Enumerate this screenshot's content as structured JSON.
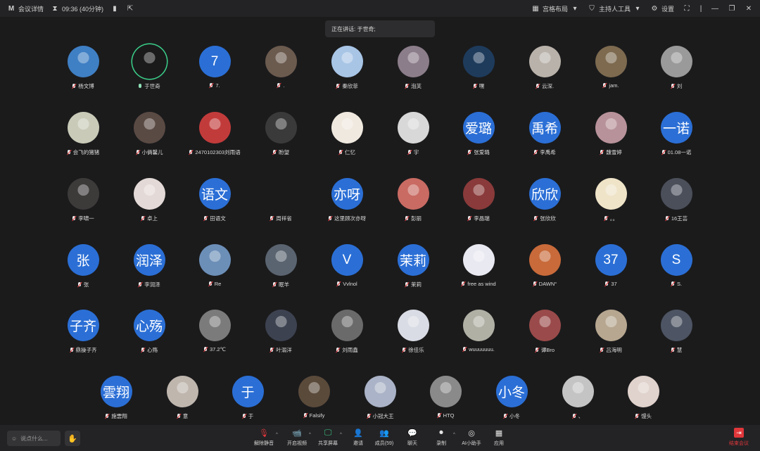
{
  "window": {
    "logo": "M",
    "app_title": "会议详情",
    "timer": "09:36 (40分钟)",
    "layout_label": "宫格布局",
    "host_tools_label": "主持人工具",
    "settings_label": "设置"
  },
  "speaker_toast": "正在讲话: 于世奇;",
  "participants": [
    {
      "name": "杨文博",
      "avatar_text": "",
      "photo": "#3f7fc4",
      "mic": "off"
    },
    {
      "name": "于世奇",
      "avatar_text": "",
      "photo": "#1a1a1a",
      "mic": "on",
      "speaking": true
    },
    {
      "name": "7.",
      "avatar_text": "7",
      "mic": "off"
    },
    {
      "name": ".",
      "avatar_text": "",
      "photo": "#6b5a4e",
      "mic": "off"
    },
    {
      "name": "秦欣菲",
      "avatar_text": "",
      "photo": "#a8c5e6",
      "mic": "off"
    },
    {
      "name": "泡芙",
      "avatar_text": "",
      "photo": "#8c7d8a",
      "mic": "off"
    },
    {
      "name": "嘿",
      "avatar_text": "",
      "photo": "#1e3b5c",
      "mic": "off"
    },
    {
      "name": "云深.",
      "avatar_text": "",
      "photo": "#b9b2aa",
      "mic": "off"
    },
    {
      "name": "jam.",
      "avatar_text": "",
      "photo": "#7d6a4f",
      "mic": "off"
    },
    {
      "name": "刘",
      "avatar_text": "",
      "photo": "#9a9a9a",
      "mic": "off"
    },
    {
      "name": "会飞的猪猪",
      "avatar_text": "",
      "photo": "#c9cbb8",
      "mic": "off"
    },
    {
      "name": "小俩馨儿",
      "avatar_text": "",
      "photo": "#5a4a44",
      "mic": "off"
    },
    {
      "name": "2470102303刘雨语",
      "avatar_text": "",
      "photo": "#c23b3b",
      "mic": "off"
    },
    {
      "name": "盼望",
      "avatar_text": "",
      "photo": "#3a3a3a",
      "mic": "off"
    },
    {
      "name": "仁忆",
      "avatar_text": "",
      "photo": "#f0e9df",
      "mic": "off"
    },
    {
      "name": "宇",
      "avatar_text": "",
      "photo": "#d8d8d8",
      "mic": "off"
    },
    {
      "name": "张爱璐",
      "avatar_text": "爱璐",
      "mic": "off"
    },
    {
      "name": "李禹希",
      "avatar_text": "禹希",
      "mic": "off"
    },
    {
      "name": "魏雪婷",
      "avatar_text": "",
      "photo": "#b8929a",
      "mic": "off"
    },
    {
      "name": "01.08一诺",
      "avatar_text": "一诺",
      "mic": "off"
    },
    {
      "name": "李啸一",
      "avatar_text": "",
      "photo": "#3d3a3a",
      "mic": "off"
    },
    {
      "name": "卓上",
      "avatar_text": "",
      "photo": "#e3d9d6",
      "mic": "off"
    },
    {
      "name": "田语文",
      "avatar_text": "语文",
      "mic": "off"
    },
    {
      "name": "周祥省",
      "avatar_text": "",
      "photo": "",
      "mic": "off",
      "hidden_avatar": true
    },
    {
      "name": "这里顾次亦呀",
      "avatar_text": "亦呀",
      "mic": "off"
    },
    {
      "name": "彭丽",
      "avatar_text": "",
      "photo": "#c96b63",
      "mic": "off"
    },
    {
      "name": "李晶瑞",
      "avatar_text": "",
      "photo": "#8a3a3a",
      "mic": "off"
    },
    {
      "name": "张欣欣",
      "avatar_text": "欣欣",
      "mic": "off"
    },
    {
      "name": "。。",
      "avatar_text": "",
      "photo": "#efe4c8",
      "mic": "off"
    },
    {
      "name": "16王芸",
      "avatar_text": "",
      "photo": "#4a4f5a",
      "mic": "off"
    },
    {
      "name": "张",
      "avatar_text": "张",
      "mic": "off"
    },
    {
      "name": "李润泽",
      "avatar_text": "润泽",
      "mic": "off"
    },
    {
      "name": "Re",
      "avatar_text": "",
      "photo": "#6c8fb8",
      "mic": "off"
    },
    {
      "name": "眠羊",
      "avatar_text": "",
      "photo": "#5a6470",
      "mic": "off"
    },
    {
      "name": "Vvlnol",
      "avatar_text": "V",
      "mic": "off"
    },
    {
      "name": "茉莉",
      "avatar_text": "茉莉",
      "mic": "off"
    },
    {
      "name": "free as wind",
      "avatar_text": "",
      "photo": "#e9e9f2",
      "mic": "off"
    },
    {
      "name": "DAWN°",
      "avatar_text": "",
      "photo": "#c86a3a",
      "mic": "off"
    },
    {
      "name": "37",
      "avatar_text": "37",
      "mic": "off"
    },
    {
      "name": "S.",
      "avatar_text": "S",
      "mic": "off"
    },
    {
      "name": "鼎操子齐",
      "avatar_text": "子齐",
      "mic": "off"
    },
    {
      "name": "心殇",
      "avatar_text": "心殇",
      "mic": "off"
    },
    {
      "name": "37.2℃",
      "avatar_text": "",
      "photo": "#7b7b7b",
      "mic": "off"
    },
    {
      "name": "叶溺洋",
      "avatar_text": "",
      "photo": "#3c4250",
      "mic": "off"
    },
    {
      "name": "刘雨鑫",
      "avatar_text": "",
      "photo": "#6a6a6a",
      "mic": "off"
    },
    {
      "name": "徐佳乐",
      "avatar_text": "",
      "photo": "#d9dce4",
      "mic": "off"
    },
    {
      "name": "wuuuuuuu.",
      "avatar_text": "",
      "photo": "#b0b0a5",
      "mic": "off"
    },
    {
      "name": "谭Bro",
      "avatar_text": "",
      "photo": "#9a4a4a",
      "mic": "off"
    },
    {
      "name": "吕海明",
      "avatar_text": "",
      "photo": "#b7a790",
      "mic": "off"
    },
    {
      "name": "慧",
      "avatar_text": "",
      "photo": "#4d5463",
      "mic": "off"
    },
    {
      "name": "施雲翔",
      "avatar_text": "雲翔",
      "mic": "off"
    },
    {
      "name": "意",
      "avatar_text": "",
      "photo": "#bfb6ae",
      "mic": "off"
    },
    {
      "name": "于",
      "avatar_text": "于",
      "mic": "off"
    },
    {
      "name": "Falsify",
      "avatar_text": "",
      "photo": "#5a4a3a",
      "mic": "off"
    },
    {
      "name": "小冠大王",
      "avatar_text": "",
      "photo": "#aab3c7",
      "mic": "off"
    },
    {
      "name": "HTQ",
      "avatar_text": "",
      "photo": "#8a8a8a",
      "mic": "off"
    },
    {
      "name": "小冬",
      "avatar_text": "小冬",
      "mic": "off"
    },
    {
      "name": "、",
      "avatar_text": "",
      "photo": "#c4c4c4",
      "mic": "off"
    },
    {
      "name": "馒头",
      "avatar_text": "",
      "photo": "#e0d2cc",
      "mic": "off"
    }
  ],
  "bottom": {
    "chat_placeholder": "说点什么...",
    "tools": [
      {
        "label": "解除静音",
        "icon": "mic-muted-icon",
        "glyph": "🎙"
      },
      {
        "label": "开启视频",
        "icon": "camera-off-icon",
        "glyph": "📹"
      },
      {
        "label": "共享屏幕",
        "icon": "share-screen-icon",
        "glyph": "🖵"
      },
      {
        "label": "邀请",
        "icon": "invite-icon",
        "glyph": "👤"
      },
      {
        "label": "成员(59)",
        "icon": "members-icon",
        "glyph": "👥"
      },
      {
        "label": "聊天",
        "icon": "chat-icon",
        "glyph": "💬"
      },
      {
        "label": "录制",
        "icon": "record-icon",
        "glyph": "⏺"
      },
      {
        "label": "AI小助手",
        "icon": "ai-assistant-icon",
        "glyph": "◎"
      },
      {
        "label": "应用",
        "icon": "apps-icon",
        "glyph": "▦"
      }
    ],
    "end_label": "结束会议"
  }
}
